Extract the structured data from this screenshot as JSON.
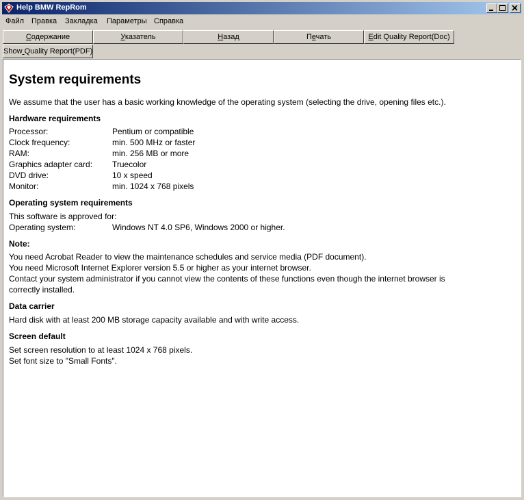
{
  "window": {
    "title": "Help BMW RepRom"
  },
  "menu": [
    "Файл",
    "Правка",
    "Закладка",
    "Параметры",
    "Справка"
  ],
  "toolbar": {
    "row1": [
      {
        "prefix": "",
        "accel": "С",
        "rest": "одержание"
      },
      {
        "prefix": "",
        "accel": "У",
        "rest": "казатель"
      },
      {
        "prefix": "",
        "accel": "Н",
        "rest": "азад"
      },
      {
        "prefix": "П",
        "accel": "е",
        "rest": "чать"
      },
      {
        "prefix": "",
        "accel": "E",
        "rest": "dit Quality Report(Doc)"
      }
    ],
    "row2": [
      {
        "prefix": "Show",
        "accel": " ",
        "rest": "Quality Report(PDF)"
      }
    ]
  },
  "doc": {
    "title": "System requirements",
    "intro": "We assume that the user has a basic working knowledge of the operating system (selecting the drive, opening files etc.).",
    "hardware_heading": "Hardware requirements",
    "hardware": [
      {
        "label": "Processor:",
        "value": "Pentium or compatible"
      },
      {
        "label": "Clock frequency:",
        "value": "min. 500 MHz or faster"
      },
      {
        "label": "RAM:",
        "value": "min. 256 MB or more"
      },
      {
        "label": "Graphics adapter card:",
        "value": "Truecolor"
      },
      {
        "label": "DVD drive:",
        "value": "10 x speed"
      },
      {
        "label": "Monitor:",
        "value": "min. 1024 x 768 pixels"
      }
    ],
    "os_heading": "Operating system requirements",
    "os_approved": "This software is approved for:",
    "os_label": "Operating system:",
    "os_value": "Windows NT 4.0 SP6, Windows 2000 or higher.",
    "note_heading": "Note:",
    "note_lines": [
      "You need Acrobat Reader to view the maintenance schedules and service media (PDF document).",
      "You need Microsoft Internet Explorer version 5.5 or higher as your internet browser.",
      "Contact your system administrator if you cannot view the contents of these functions even though the internet browser is",
      "correctly installed."
    ],
    "data_heading": "Data carrier",
    "data_text": "Hard disk with at least 200 MB storage capacity available and with write access.",
    "screen_heading": "Screen default",
    "screen_lines": [
      "Set screen resolution to at least 1024 x 768 pixels.",
      "Set font size to \"Small Fonts\"."
    ]
  }
}
